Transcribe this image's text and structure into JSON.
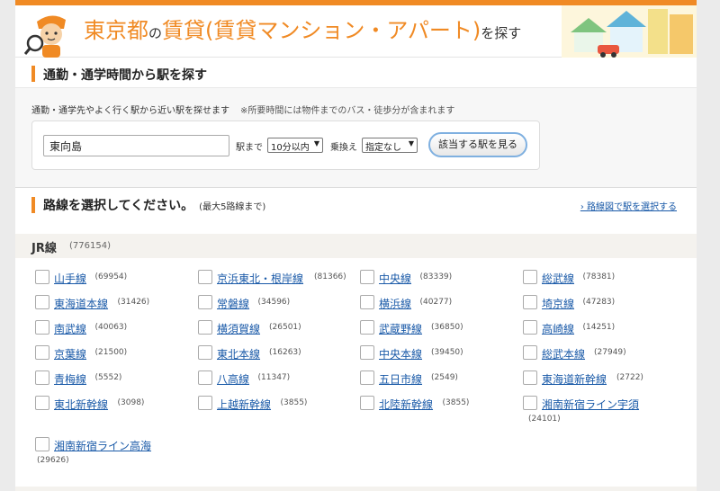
{
  "header": {
    "title_main": "東京都",
    "title_no": "の",
    "title_rest": "賃貸(賃貸マンション・アパート)",
    "title_suffix": "を探す"
  },
  "commute": {
    "heading": "通勤・通学時間から駅を探す",
    "description": "通勤・通学先やよく行く駅から近い駅を探せます",
    "note": "※所要時間には物件までのバス・徒歩分が含まれます",
    "station_value": "東向島",
    "to_station_label": "駅まで",
    "time_value": "10分以内",
    "transfer_label": "乗換え",
    "transfer_value": "指定なし",
    "find_button": "該当する駅を見る"
  },
  "lines_section": {
    "heading": "路線を選択してください。",
    "heading_note": "(最大5路線まで)",
    "map_link": "路線図で駅を選択する",
    "group_name": "JR線",
    "group_count": "(776154)",
    "lines": [
      {
        "name": "山手線",
        "count": "(69954)"
      },
      {
        "name": "京浜東北・根岸線",
        "count": "(81366)"
      },
      {
        "name": "中央線",
        "count": "(83339)"
      },
      {
        "name": "総武線",
        "count": "(78381)"
      },
      {
        "name": "東海道本線",
        "count": "(31426)"
      },
      {
        "name": "常磐線",
        "count": "(34596)"
      },
      {
        "name": "横浜線",
        "count": "(40277)"
      },
      {
        "name": "埼京線",
        "count": "(47283)"
      },
      {
        "name": "南武線",
        "count": "(40063)"
      },
      {
        "name": "横須賀線",
        "count": "(26501)"
      },
      {
        "name": "武蔵野線",
        "count": "(36850)"
      },
      {
        "name": "高崎線",
        "count": "(14251)"
      },
      {
        "name": "京葉線",
        "count": "(21500)"
      },
      {
        "name": "東北本線",
        "count": "(16263)"
      },
      {
        "name": "中央本線",
        "count": "(39450)"
      },
      {
        "name": "総武本線",
        "count": "(27949)"
      },
      {
        "name": "青梅線",
        "count": "(5552)"
      },
      {
        "name": "八高線",
        "count": "(11347)"
      },
      {
        "name": "五日市線",
        "count": "(2549)"
      },
      {
        "name": "東海道新幹線",
        "count": "(2722)"
      },
      {
        "name": "東北新幹線",
        "count": "(3098)"
      },
      {
        "name": "上越新幹線",
        "count": "(3855)"
      },
      {
        "name": "北陸新幹線",
        "count": "(3855)"
      },
      {
        "name": "湘南新宿ライン宇須",
        "count": "(24101)"
      },
      {
        "name": "湘南新宿ライン高海",
        "count": "(29626)"
      }
    ]
  }
}
